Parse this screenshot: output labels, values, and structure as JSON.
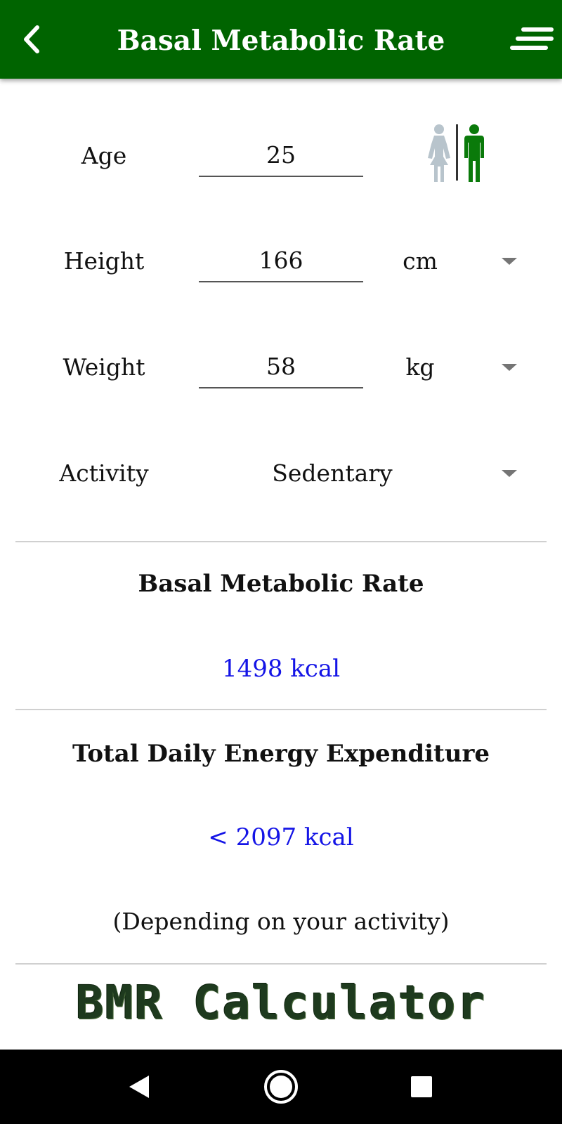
{
  "app_bar": {
    "title": "Basal Metabolic Rate",
    "background_color": "#006400",
    "back_icon": "chevron-left-icon",
    "menu_icon": "menu-lines-icon"
  },
  "form": {
    "age": {
      "label": "Age",
      "value": "25"
    },
    "gender": {
      "female_icon": "female-figure-icon",
      "male_icon": "male-figure-icon",
      "selected": "male",
      "selected_color": "#0a7a0a",
      "unselected_color": "#b8c4cc"
    },
    "height": {
      "label": "Height",
      "value": "166",
      "unit": "cm"
    },
    "weight": {
      "label": "Weight",
      "value": "58",
      "unit": "kg"
    },
    "activity": {
      "label": "Activity",
      "value": "Sedentary"
    }
  },
  "results": {
    "bmr": {
      "heading": "Basal Metabolic Rate",
      "value": "1498 kcal"
    },
    "tdee": {
      "heading": "Total Daily Energy Expenditure",
      "value": "< 2097 kcal",
      "note": "(Depending on your activity)"
    },
    "value_color": "#1414e6"
  },
  "logo": {
    "text": "BMR Calculator",
    "color": "#1e3a1e"
  },
  "nav_bar": {
    "back_icon": "triangle-back-icon",
    "home_icon": "circle-home-icon",
    "recents_icon": "square-recents-icon"
  }
}
